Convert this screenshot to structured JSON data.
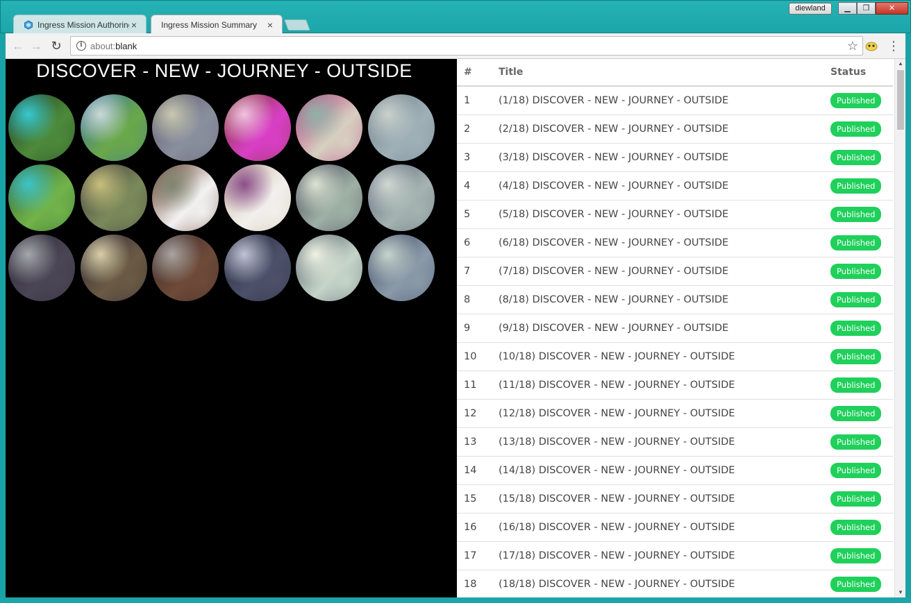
{
  "window": {
    "user": "diewland",
    "controls": {
      "minimize": "▁",
      "maximize": "❐",
      "close": "✕"
    }
  },
  "tabs": [
    {
      "label": "Ingress Mission Authoring",
      "active": false,
      "icon": "ingress-icon"
    },
    {
      "label": "Ingress Mission Summary",
      "active": true
    }
  ],
  "toolbar": {
    "back": "←",
    "forward": "→",
    "reload": "↻",
    "url_scheme": "about:",
    "url_rest": "blank",
    "star": "☆",
    "menu": "⋮"
  },
  "mission": {
    "title": "DISCOVER - NEW - JOURNEY - OUTSIDE",
    "portals": [
      {
        "colors": [
          "#1f3b25",
          "#4d8a3a",
          "#38c8cf"
        ]
      },
      {
        "colors": [
          "#3a6fa0",
          "#6aa84a",
          "#c9d9d8"
        ]
      },
      {
        "colors": [
          "#5a5a6a",
          "#8a8f9e",
          "#c8c8b0"
        ]
      },
      {
        "colors": [
          "#7a3a2a",
          "#d93fc6",
          "#f1c2e0"
        ]
      },
      {
        "colors": [
          "#b9327f",
          "#d7d0c0",
          "#8fb2a6"
        ]
      },
      {
        "colors": [
          "#6e7f8a",
          "#9fb0b7",
          "#c9d1cc"
        ]
      },
      {
        "colors": [
          "#2c5e2f",
          "#72b34a",
          "#3fc3c8"
        ]
      },
      {
        "colors": [
          "#3d3a3e",
          "#7b8a5a",
          "#c7c07c"
        ]
      },
      {
        "colors": [
          "#6b3a2b",
          "#f2f2f2",
          "#7f8570"
        ]
      },
      {
        "colors": [
          "#c9b7a8",
          "#f2f0ec",
          "#8c4f8a"
        ]
      },
      {
        "colors": [
          "#3c3f52",
          "#9fb1a6",
          "#dbe3d2"
        ]
      },
      {
        "colors": [
          "#59617a",
          "#a4b4b0",
          "#d0d8d2"
        ]
      },
      {
        "colors": [
          "#2d2a38",
          "#4a4656",
          "#a5a7ac"
        ]
      },
      {
        "colors": [
          "#2b2835",
          "#6b5a44",
          "#d8cfa8"
        ]
      },
      {
        "colors": [
          "#3a2a2c",
          "#6e4a38",
          "#a9a4a0"
        ]
      },
      {
        "colors": [
          "#2a2c40",
          "#4c5069",
          "#bfc3d3"
        ]
      },
      {
        "colors": [
          "#4a5666",
          "#c6d5c9",
          "#eef2e2"
        ]
      },
      {
        "colors": [
          "#3e4a66",
          "#8a9aa8",
          "#c7d3cc"
        ]
      }
    ]
  },
  "table": {
    "headers": {
      "num": "#",
      "title": "Title",
      "status": "Status"
    },
    "rows": [
      {
        "num": "1",
        "title": "(1/18) DISCOVER - NEW - JOURNEY - OUTSIDE",
        "status": "Published"
      },
      {
        "num": "2",
        "title": "(2/18) DISCOVER - NEW - JOURNEY - OUTSIDE",
        "status": "Published"
      },
      {
        "num": "3",
        "title": "(3/18) DISCOVER - NEW - JOURNEY - OUTSIDE",
        "status": "Published"
      },
      {
        "num": "4",
        "title": "(4/18) DISCOVER - NEW - JOURNEY - OUTSIDE",
        "status": "Published"
      },
      {
        "num": "5",
        "title": "(5/18) DISCOVER - NEW - JOURNEY - OUTSIDE",
        "status": "Published"
      },
      {
        "num": "6",
        "title": "(6/18) DISCOVER - NEW - JOURNEY - OUTSIDE",
        "status": "Published"
      },
      {
        "num": "7",
        "title": "(7/18) DISCOVER - NEW - JOURNEY - OUTSIDE",
        "status": "Published"
      },
      {
        "num": "8",
        "title": "(8/18) DISCOVER - NEW - JOURNEY - OUTSIDE",
        "status": "Published"
      },
      {
        "num": "9",
        "title": "(9/18) DISCOVER - NEW - JOURNEY - OUTSIDE",
        "status": "Published"
      },
      {
        "num": "10",
        "title": "(10/18) DISCOVER - NEW - JOURNEY - OUTSIDE",
        "status": "Published"
      },
      {
        "num": "11",
        "title": "(11/18) DISCOVER - NEW - JOURNEY - OUTSIDE",
        "status": "Published"
      },
      {
        "num": "12",
        "title": "(12/18) DISCOVER - NEW - JOURNEY - OUTSIDE",
        "status": "Published"
      },
      {
        "num": "13",
        "title": "(13/18) DISCOVER - NEW - JOURNEY - OUTSIDE",
        "status": "Published"
      },
      {
        "num": "14",
        "title": "(14/18) DISCOVER - NEW - JOURNEY - OUTSIDE",
        "status": "Published"
      },
      {
        "num": "15",
        "title": "(15/18) DISCOVER - NEW - JOURNEY - OUTSIDE",
        "status": "Published"
      },
      {
        "num": "16",
        "title": "(16/18) DISCOVER - NEW - JOURNEY - OUTSIDE",
        "status": "Published"
      },
      {
        "num": "17",
        "title": "(17/18) DISCOVER - NEW - JOURNEY - OUTSIDE",
        "status": "Published"
      },
      {
        "num": "18",
        "title": "(18/18) DISCOVER - NEW - JOURNEY - OUTSIDE",
        "status": "Published"
      }
    ]
  },
  "colors": {
    "published": "#1fd05b",
    "titlebar": "#1ca6a9"
  }
}
